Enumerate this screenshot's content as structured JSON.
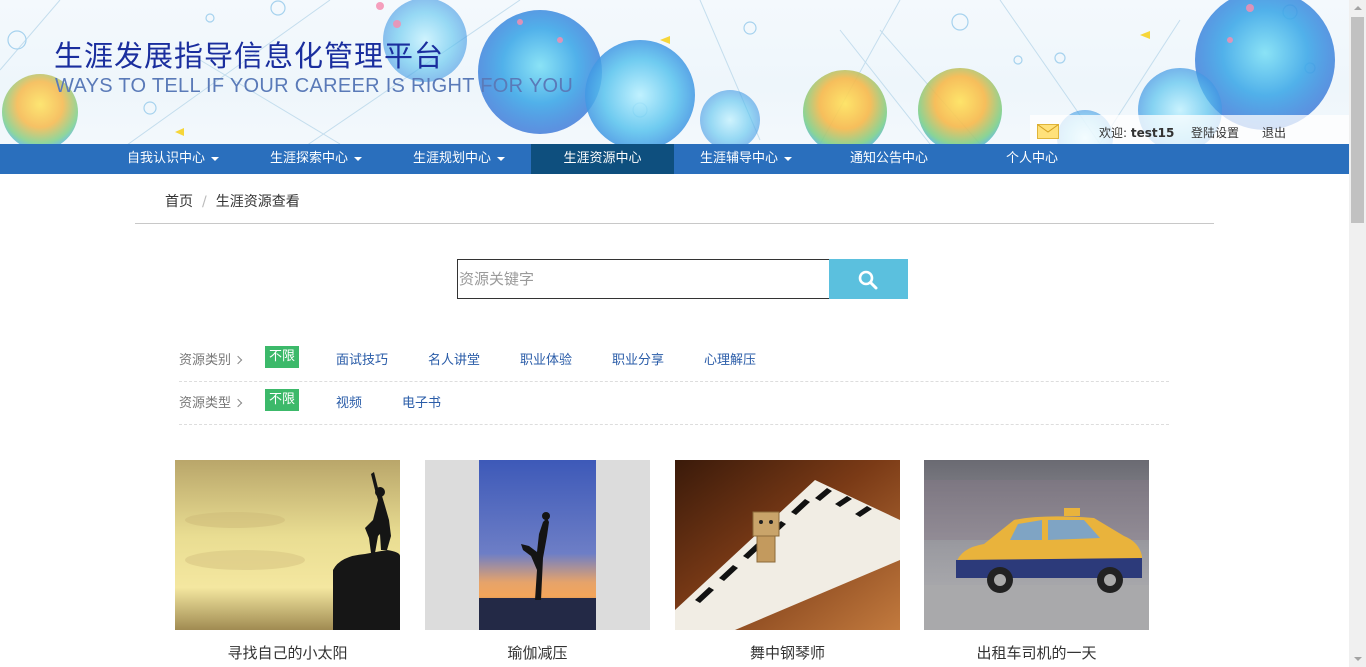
{
  "header": {
    "title": "生涯发展指导信息化管理平台",
    "subtitle": "WAYS TO TELL IF YOUR CAREER IS RIGHT FOR YOU",
    "welcome_prefix": "欢迎: ",
    "username": "test15",
    "login_settings": "登陆设置",
    "logout": "退出"
  },
  "nav": {
    "items": [
      {
        "label": "自我认识中心",
        "dropdown": true
      },
      {
        "label": "生涯探索中心",
        "dropdown": true
      },
      {
        "label": "生涯规划中心",
        "dropdown": true
      },
      {
        "label": "生涯资源中心",
        "active": true
      },
      {
        "label": "生涯辅导中心",
        "dropdown": true
      },
      {
        "label": "通知公告中心"
      },
      {
        "label": "个人中心"
      }
    ]
  },
  "breadcrumb": {
    "home": "首页",
    "separator": "/",
    "current": "生涯资源查看"
  },
  "search": {
    "placeholder": "资源关键字",
    "icon": "search-icon"
  },
  "filters": {
    "category": {
      "label": "资源类别",
      "options": [
        "不限",
        "面试技巧",
        "名人讲堂",
        "职业体验",
        "职业分享",
        "心理解压"
      ],
      "selected": "不限"
    },
    "type": {
      "label": "资源类型",
      "options": [
        "不限",
        "视频",
        "电子书"
      ],
      "selected": "不限"
    }
  },
  "resources": [
    {
      "title": "寻找自己的小太阳"
    },
    {
      "title": "瑜伽减压"
    },
    {
      "title": "舞中钢琴师"
    },
    {
      "title": "出租车司机的一天"
    }
  ],
  "colors": {
    "nav_bg": "#2a6fbd",
    "nav_active": "#0e4f7e",
    "title": "#1a2e9e",
    "search_button": "#5bc0de",
    "selected_filter": "#3cb96a",
    "link": "#2a5ca8"
  }
}
